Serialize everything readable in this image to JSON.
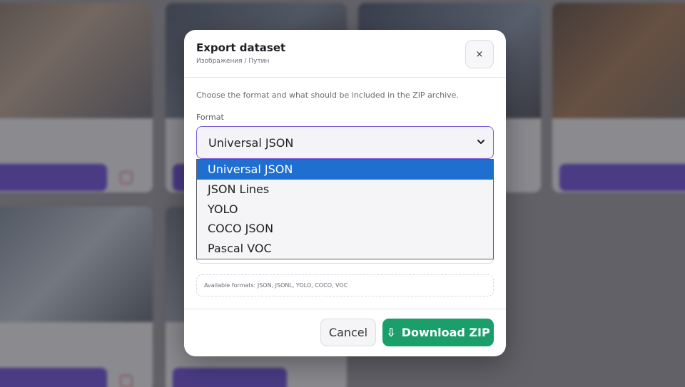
{
  "modal": {
    "title": "Export dataset",
    "breadcrumb": "Изображения / Путин",
    "close_label": "×",
    "description": "Choose the format and what should be included in the ZIP archive.",
    "format_label": "Format",
    "format_value": "Universal JSON",
    "hint": "Available formats: JSON, JSONL, YOLO, COCO, VOC",
    "cancel_label": "Cancel",
    "download_label": "Download ZIP",
    "download_icon": "download-arrow-icon"
  },
  "dropdown": {
    "options": [
      "Universal JSON",
      "JSON Lines",
      "YOLO",
      "COCO JSON",
      "Pascal VOC"
    ],
    "selected_index": 0
  },
  "colors": {
    "accent": "#7a5cd9",
    "primary_button": "#1a9e6a",
    "selected_option": "#1f6fd1",
    "card_button": "#5b3bd6"
  }
}
